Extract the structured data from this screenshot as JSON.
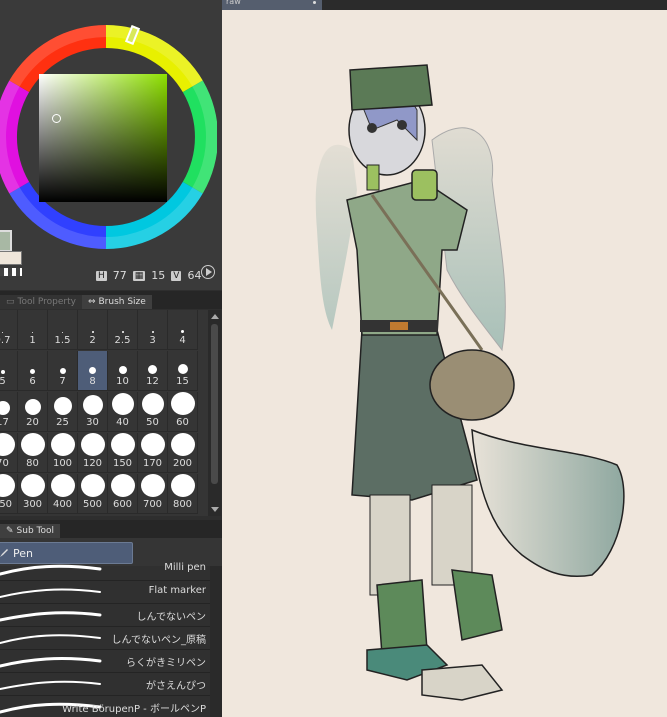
{
  "color_panel": {
    "title": "Color Wheel",
    "hue_value": "77",
    "saturation_value": "15",
    "brightness_value": "64",
    "hue_label": "H",
    "brightness_label": "V",
    "main_color": "#a8b8a4",
    "sub_color": "#efe6da",
    "icons": {
      "wheel": "color-wheel-icon",
      "toggle": "play-circle-icon"
    }
  },
  "tool_tabs": {
    "tool_property": "Tool Property",
    "brush_size": "Brush Size"
  },
  "brush_sizes": {
    "rows": [
      [
        "0.7",
        "1",
        "1.5",
        "2",
        "2.5",
        "3",
        "4"
      ],
      [
        "5",
        "6",
        "7",
        "8",
        "10",
        "12",
        "15"
      ],
      [
        "17",
        "20",
        "25",
        "30",
        "40",
        "50",
        "60"
      ],
      [
        "70",
        "80",
        "100",
        "120",
        "150",
        "170",
        "200"
      ],
      [
        "250",
        "300",
        "400",
        "500",
        "600",
        "700",
        "800"
      ]
    ],
    "selected": "8"
  },
  "subtool": {
    "tab_label": "Sub Tool",
    "group": "Pen",
    "brushes": [
      "Milli pen",
      "Flat marker",
      "しんでないペン",
      "しんでないペン_原稿",
      "らくがきミリペン",
      "がさえんぴつ",
      "Write BörupenP - ボールペンP"
    ]
  },
  "document": {
    "tab_title": "raw"
  },
  "colors": {
    "selection": "#4e5d78",
    "canvas_bg": "#f0e7dd",
    "panel_bg": "#353535"
  }
}
